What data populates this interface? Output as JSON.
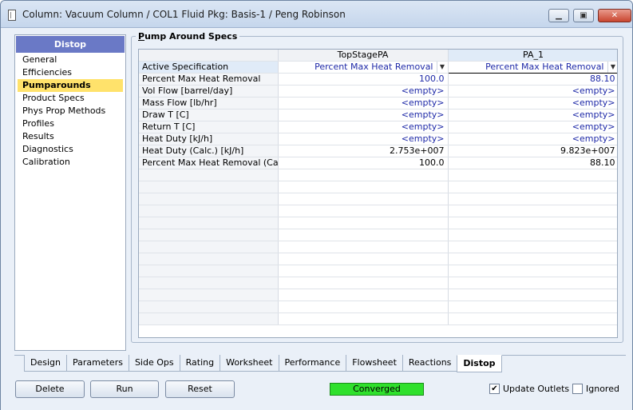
{
  "window": {
    "title": "Column: Vacuum Column / COL1  Fluid Pkg: Basis-1 / Peng Robinson",
    "minimize": "▁",
    "maximize": "▣",
    "close": "✕"
  },
  "nav": {
    "header": "Distop",
    "items": [
      {
        "label": "General"
      },
      {
        "label": "Efficiencies"
      },
      {
        "label": "Pumparounds",
        "active": true
      },
      {
        "label": "Product Specs"
      },
      {
        "label": "Phys Prop Methods"
      },
      {
        "label": "Profiles"
      },
      {
        "label": "Results"
      },
      {
        "label": "Diagnostics"
      },
      {
        "label": "Calibration"
      }
    ]
  },
  "group": {
    "title_first": "P",
    "title_rest": "ump Around Specs"
  },
  "grid": {
    "columns": [
      "TopStagePA",
      "PA_1"
    ],
    "rows": [
      {
        "label": "Active Specification",
        "values": [
          "Percent Max Heat Removal",
          "Percent Max Heat Removal"
        ]
      },
      {
        "label": "Percent Max Heat Removal",
        "values": [
          "100.0",
          "88.10"
        ]
      },
      {
        "label": "Vol Flow [barrel/day]",
        "values": [
          "<empty>",
          "<empty>"
        ]
      },
      {
        "label": "Mass Flow [lb/hr]",
        "values": [
          "<empty>",
          "<empty>"
        ]
      },
      {
        "label": "Draw T [C]",
        "values": [
          "<empty>",
          "<empty>"
        ]
      },
      {
        "label": "Return T [C]",
        "values": [
          "<empty>",
          "<empty>"
        ]
      },
      {
        "label": "Heat Duty [kJ/h]",
        "values": [
          "<empty>",
          "<empty>"
        ]
      },
      {
        "label": "Heat Duty (Calc.) [kJ/h]",
        "values": [
          "2.753e+007",
          "9.823e+007"
        ]
      },
      {
        "label": "Percent Max Heat Removal (Calc.)",
        "values": [
          "100.0",
          "88.10"
        ]
      }
    ]
  },
  "tabs": [
    "Design",
    "Parameters",
    "Side Ops",
    "Rating",
    "Worksheet",
    "Performance",
    "Flowsheet",
    "Reactions",
    "Distop"
  ],
  "active_tab": "Distop",
  "buttons": {
    "delete": "Delete",
    "run": "Run",
    "reset": "Reset"
  },
  "status": {
    "text": "Converged",
    "color": "#2fe02c"
  },
  "checkboxes": {
    "update_outlets": {
      "label": "Update Outlets",
      "checked": true
    },
    "ignored": {
      "label": "Ignored",
      "checked": false
    }
  },
  "colors": {
    "nav_header": "#6a79c6",
    "active_nav": "#ffe26b",
    "value_text": "#1f2aa8"
  }
}
